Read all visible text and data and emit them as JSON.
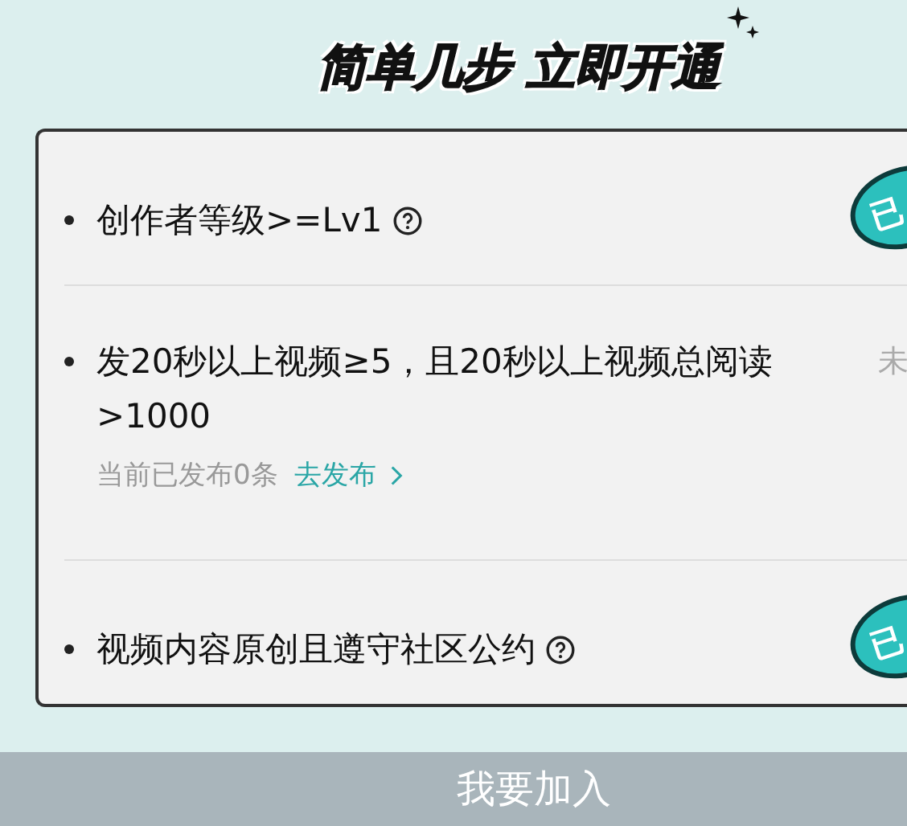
{
  "heading": "简单几步 立即开通",
  "requirements": [
    {
      "text": "创作者等级>=Lv1",
      "help": true,
      "status": {
        "kind": "stamp",
        "text": "已"
      }
    },
    {
      "text": "发20秒以上视频≥5，且20秒以上视频总阅读>1000",
      "help": false,
      "status": {
        "kind": "pending",
        "text": "未"
      },
      "progress": "当前已发布0条",
      "action": "去发布"
    },
    {
      "text": "视频内容原创且遵守社区公约",
      "help": true,
      "status": {
        "kind": "stamp",
        "text": "已"
      }
    }
  ],
  "join_button": "我要加入"
}
